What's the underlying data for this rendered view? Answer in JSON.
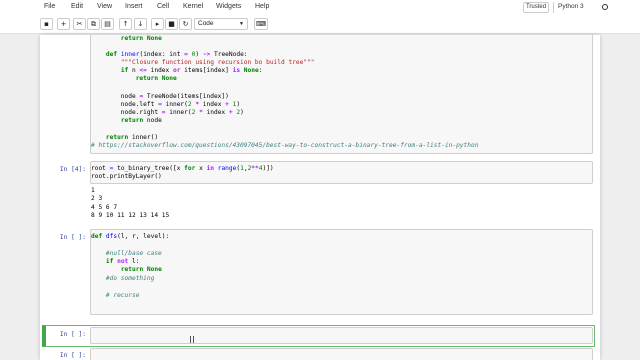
{
  "menu": [
    "File",
    "Edit",
    "View",
    "Insert",
    "Cell",
    "Kernel",
    "Widgets",
    "Help"
  ],
  "trusted": "Trusted",
  "kernel": "Python 3",
  "cell_type": "Code",
  "cells": [
    {
      "prompt": "",
      "lines": [
        "        return None",
        "",
        "    def inner(index: int = 0) -> TreeNode:",
        "        \"\"\"Closure function using recursion bo build tree\"\"\"",
        "        if n <= index or items[index] is None:",
        "            return None",
        "",
        "        node = TreeNode(items[index])",
        "        node.left = inner(2 * index + 1)",
        "        node.right = inner(2 * index + 2)",
        "        return node",
        "",
        "    return inner()",
        "# https://stackoverflow.com/questions/43097045/best-way-to-construct-a-binary-tree-from-a-list-in-python"
      ]
    },
    {
      "prompt": "In [4]:",
      "lines": [
        "root = to_binary_tree([x for x in range(1,2**4)])",
        "root.printByLayer()"
      ],
      "output": [
        "1",
        "2 3",
        "4 5 6 7",
        "8 9 10 11 12 13 14 15"
      ]
    },
    {
      "prompt": "In [ ]:",
      "lines": [
        "def dfs(l, r, level):",
        "",
        "    #null/base case",
        "    if not l:",
        "        return None",
        "    #do something",
        "",
        "    # recurse"
      ]
    },
    {
      "prompt": "In [ ]:",
      "lines": [
        ""
      ]
    },
    {
      "prompt": "In [ ]:",
      "lines": [
        ""
      ]
    }
  ]
}
